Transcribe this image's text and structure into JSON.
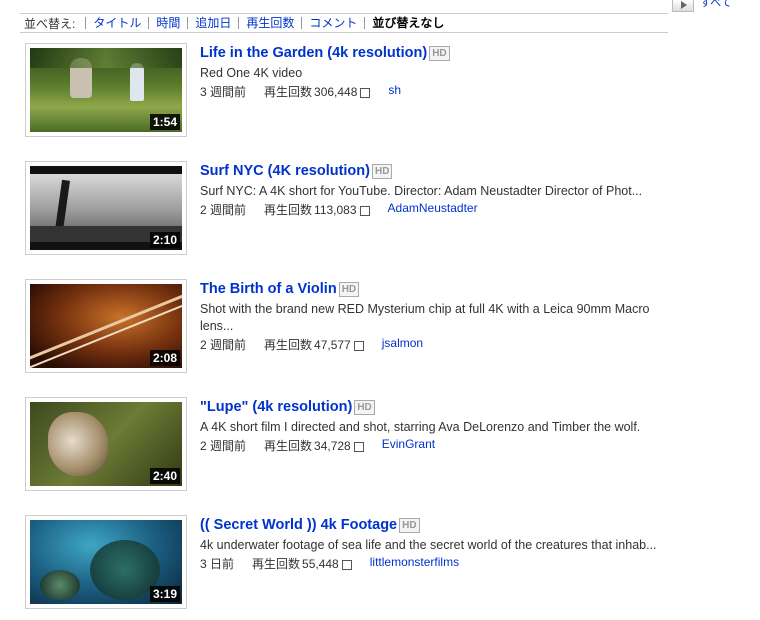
{
  "sort": {
    "label": "並べ替え:",
    "options": [
      "タイトル",
      "時間",
      "追加日",
      "再生回数",
      "コメント",
      "並び替えなし"
    ],
    "active": "並び替えなし"
  },
  "hd_badge": "HD",
  "views_label": "再生回数",
  "videos": [
    {
      "title": "Life in the Garden (4k resolution)",
      "description": "Red One 4K video",
      "age": "3 週間前",
      "views": "306,448",
      "user": "sh",
      "duration": "1:54"
    },
    {
      "title": "Surf NYC (4K resolution)",
      "description": "Surf NYC: A 4K short for YouTube. Director: Adam Neustadter Director of Phot...",
      "age": "2 週間前",
      "views": "113,083",
      "user": "AdamNeustadter",
      "duration": "2:10"
    },
    {
      "title": "The Birth of a Violin",
      "description": "Shot with the brand new RED Mysterium chip at full 4K with a Leica 90mm Macro lens...",
      "age": "2 週間前",
      "views": "47,577",
      "user": "jsalmon",
      "duration": "2:08"
    },
    {
      "title": "\"Lupe\" (4k resolution)",
      "description": "A 4K short film I directed and shot, starring Ava DeLorenzo and Timber the wolf.",
      "age": "2 週間前",
      "views": "34,728",
      "user": "EvinGrant",
      "duration": "2:40"
    },
    {
      "title": "(( Secret World )) 4k Footage",
      "description": "4k underwater footage of sea life and the secret world of the creatures that inhab...",
      "age": "3 日前",
      "views": "55,448",
      "user": "littlemonsterfilms",
      "duration": "3:19"
    }
  ]
}
